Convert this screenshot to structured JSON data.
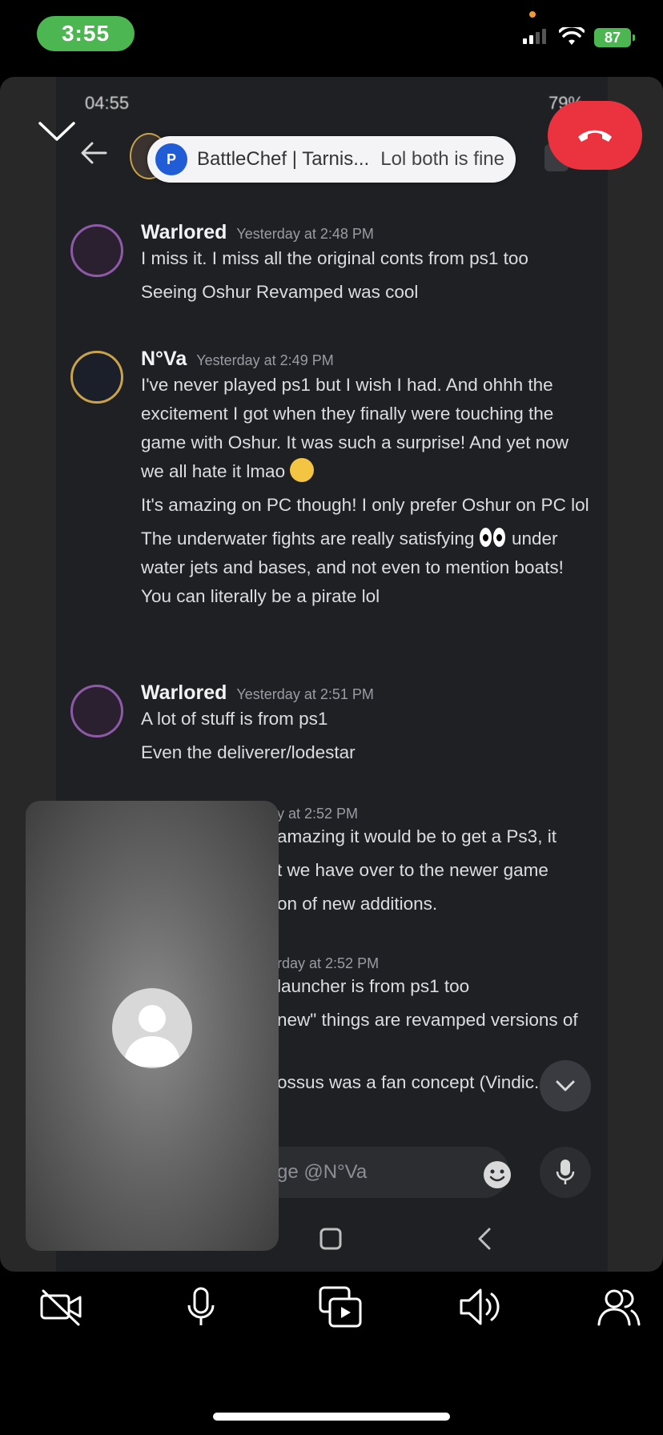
{
  "ios_status": {
    "time": "3:55",
    "battery": "87"
  },
  "shared_screen": {
    "android_status": {
      "left": "04:55",
      "right": "79%"
    },
    "notification": {
      "sender": "BattleChef | Tarnis...",
      "message": "Lol both is fine"
    },
    "messages": [
      {
        "author": "Warlored",
        "time": "Yesterday at 2:48 PM",
        "lines": [
          "I miss it. I miss all the original conts from ps1 too",
          "Seeing Oshur Revamped was cool"
        ]
      },
      {
        "author": "N°Va",
        "time": "Yesterday at 2:49 PM",
        "lines": [
          "I've never played ps1 but I wish I had. And ohhh the excitement I got when they finally were touching the game with Oshur. It was such a surprise! And yet now we all hate it lmao",
          "It's amazing on PC though! I only prefer Oshur on PC lol",
          "The underwater fights are really satisfying",
          "under water jets and bases, and not even to mention boats! You can literally be a pirate lol"
        ]
      },
      {
        "author": "Warlored",
        "time": "Yesterday at 2:51 PM",
        "lines": [
          "A lot of stuff is from ps1",
          "Even the deliverer/lodestar"
        ]
      },
      {
        "time": "y at 2:52 PM",
        "lines": [
          "amazing it would be to get a Ps3, it",
          "t we have over to the newer game",
          "on of new additions."
        ]
      },
      {
        "time": "rday at 2:52 PM",
        "lines": [
          "launcher is from ps1 too",
          "new\" things are revamped versions of",
          "ossus was a fan concept (Vindic..."
        ]
      }
    ],
    "composer_placeholder": "ge @N°Va"
  },
  "toolbar": {
    "buttons": [
      "camera-off",
      "microphone",
      "share-screen",
      "speaker",
      "participants"
    ]
  },
  "colors": {
    "end_call": "#eb3340",
    "status_green": "#4cb650",
    "discord_bg": "#1f2024"
  }
}
